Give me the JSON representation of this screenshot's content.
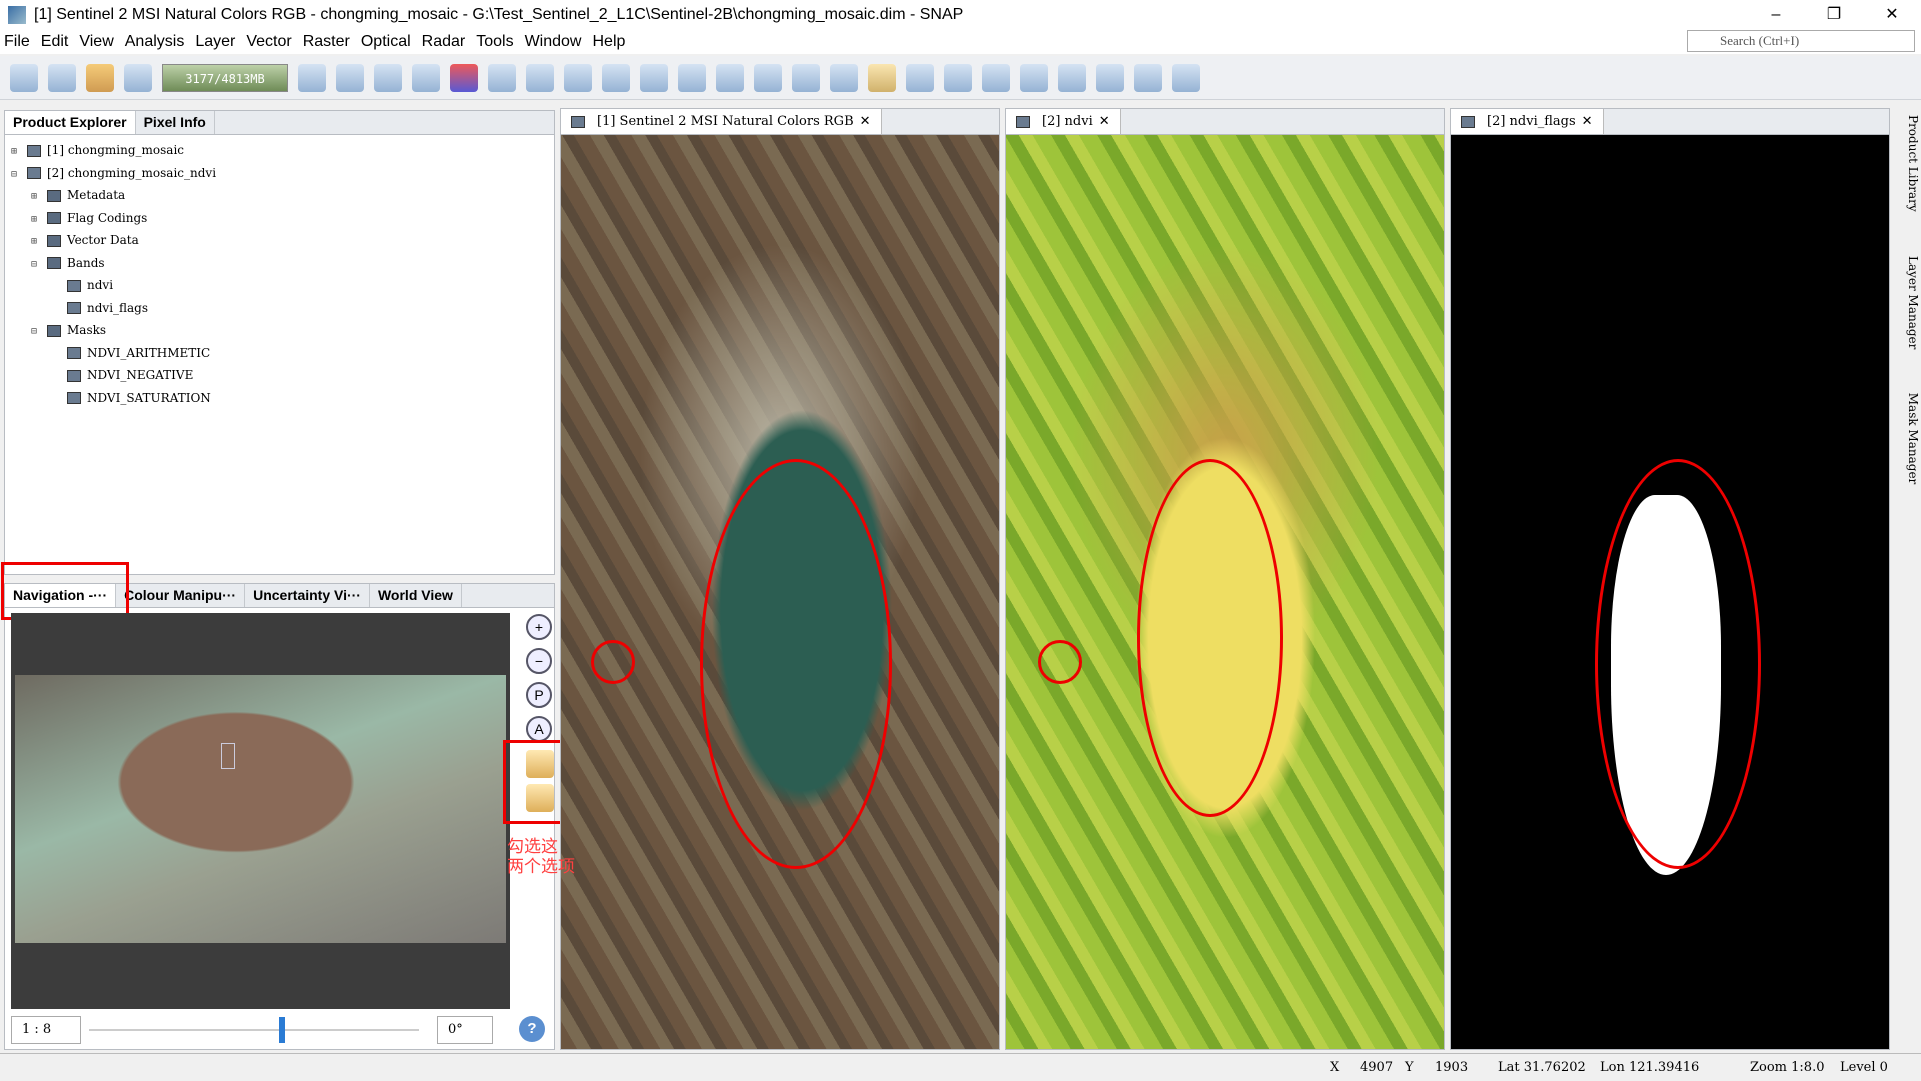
{
  "window": {
    "title": "[1] Sentinel 2 MSI Natural Colors RGB - chongming_mosaic - G:\\Test_Sentinel_2_L1C\\Sentinel-2B\\chongming_mosaic.dim - SNAP",
    "minimize": "–",
    "restore": "❐",
    "close": "✕"
  },
  "menu": [
    "File",
    "Edit",
    "View",
    "Analysis",
    "Layer",
    "Vector",
    "Raster",
    "Optical",
    "Radar",
    "Tools",
    "Window",
    "Help"
  ],
  "toolbar": {
    "memory": "3177/4813MB",
    "search_placeholder": "Search (Ctrl+I)"
  },
  "explorer": {
    "tabs": [
      "Product Explorer",
      "Pixel Info"
    ],
    "tree": [
      {
        "exp": "⊞",
        "label": "[1]  chongming_mosaic",
        "level": 0
      },
      {
        "exp": "⊟",
        "label": "[2]  chongming_mosaic_ndvi",
        "level": 0
      },
      {
        "exp": "⊞",
        "label": "Metadata",
        "level": 1
      },
      {
        "exp": "⊞",
        "label": "Flag Codings",
        "level": 1
      },
      {
        "exp": "⊞",
        "label": "Vector Data",
        "level": 1
      },
      {
        "exp": "⊟",
        "label": "Bands",
        "level": 1
      },
      {
        "exp": "",
        "label": "ndvi",
        "level": 2
      },
      {
        "exp": "",
        "label": "ndvi_flags",
        "level": 2
      },
      {
        "exp": "⊟",
        "label": "Masks",
        "level": 1
      },
      {
        "exp": "",
        "label": "NDVI_ARITHMETIC",
        "level": 2
      },
      {
        "exp": "",
        "label": "NDVI_NEGATIVE",
        "level": 2
      },
      {
        "exp": "",
        "label": "NDVI_SATURATION",
        "level": 2
      }
    ]
  },
  "nav": {
    "tabs": [
      "Navigation -···",
      "Colour Manipu···",
      "Uncertainty Vi···",
      "World View"
    ],
    "scale": "1 : 8",
    "rotation": "0°",
    "annotation": "勾选这\n两个选项",
    "help": "?"
  },
  "views": [
    {
      "title": "[1] Sentinel 2 MSI Natural Colors RGB"
    },
    {
      "title": "[2] ndvi"
    },
    {
      "title": "[2] ndvi_flags"
    }
  ],
  "side_tabs": [
    "Product Library",
    "Layer Manager",
    "Mask Manager"
  ],
  "status": {
    "x_label": "X",
    "x": "4907",
    "y_label": "Y",
    "y": "1903",
    "lat": "Lat 31.76202",
    "lon": "Lon 121.39416",
    "zoom": "Zoom 1:8.0",
    "level": "Level 0"
  },
  "colors": {
    "highlight": "#e00000"
  }
}
